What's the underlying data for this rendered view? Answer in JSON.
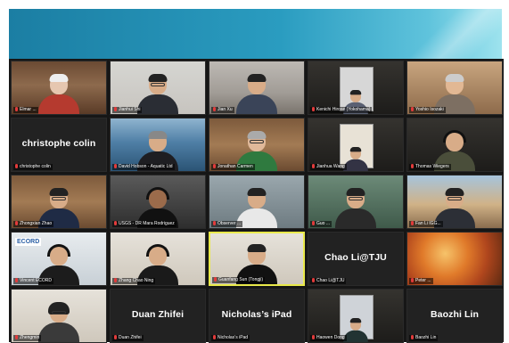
{
  "app": {
    "banner_colors": [
      "#1b7ea3",
      "#5fc3dc"
    ]
  },
  "tiles": [
    {
      "name": "Elmar ...",
      "video": true
    },
    {
      "name": "Jianhui Shi",
      "video": true
    },
    {
      "name": "Jian Xu",
      "video": true
    },
    {
      "name": "Kenichi Hirose (Yokohama)",
      "video": true
    },
    {
      "name": "Yoshio Isozaki",
      "video": true
    },
    {
      "name": "christophe colin",
      "display_name": "christophe colin",
      "video": false
    },
    {
      "name": "David Hobson - Aquatic Ltd",
      "video": true
    },
    {
      "name": "Jonathan Carmen",
      "video": true
    },
    {
      "name": "Jianhua Wang",
      "video": true
    },
    {
      "name": "Thomas Wiegers",
      "video": true
    },
    {
      "name": "Zhongxian Zhao",
      "video": true
    },
    {
      "name": "USGS - DR Mara Rodriguez",
      "video": true
    },
    {
      "name": "Observer ...",
      "video": true
    },
    {
      "name": "Guo ...",
      "video": true
    },
    {
      "name": "Fan Li IGG...",
      "video": true
    },
    {
      "name": "Vincent ECORD",
      "video": true
    },
    {
      "name": "Zhang Chao Ning",
      "video": true
    },
    {
      "name": "Guanfang Sun (Tongji)",
      "video": true,
      "active_speaker": true
    },
    {
      "name": "Chao Li@TJU",
      "display_name": "Chao Li@TJU",
      "video": false
    },
    {
      "name": "Peter ...",
      "video": true
    },
    {
      "name": "Zhengmin",
      "video": true
    },
    {
      "name": "Duan Zhifei",
      "display_name": "Duan Zhifei",
      "video": false
    },
    {
      "name": "Nicholas’s iPad",
      "display_name": "Nicholas’s iPad",
      "video": false
    },
    {
      "name": "Haowen Dong",
      "video": true
    },
    {
      "name": "Baozhi Lin",
      "display_name": "Baozhi Lin",
      "video": false
    }
  ],
  "colors": {
    "active_border": "#e9e94a",
    "tile_bg": "#222222",
    "muted_mic": "#e23b3b"
  }
}
